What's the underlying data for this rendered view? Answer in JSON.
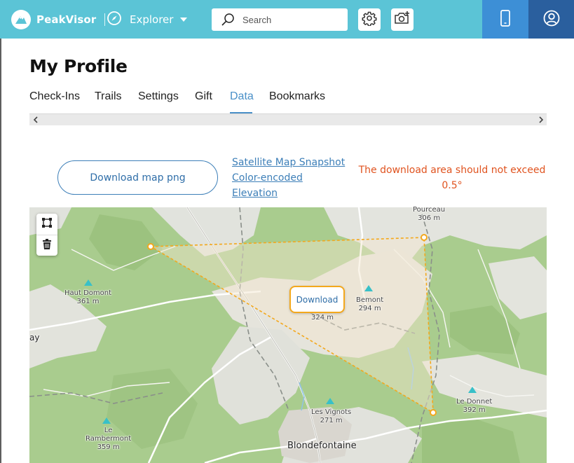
{
  "header": {
    "brand": "PeakVisor",
    "explorer_label": "Explorer",
    "search_placeholder": "Search"
  },
  "page": {
    "title": "My Profile",
    "tabs": [
      {
        "label": "Check-Ins",
        "active": false
      },
      {
        "label": "Trails",
        "active": false
      },
      {
        "label": "Settings",
        "active": false
      },
      {
        "label": "Gift",
        "active": false
      },
      {
        "label": "Data",
        "active": true
      },
      {
        "label": "Bookmarks",
        "active": false
      }
    ]
  },
  "actions": {
    "download_png_label": "Download map png",
    "links": [
      "Satellite Map Snapshot",
      "Color-encoded",
      "Elevation"
    ],
    "warning": "The download area should not exceed 0.5°"
  },
  "map": {
    "download_label": "Download",
    "labels": {
      "haut_domont": {
        "name": "Haut Domont",
        "elev": "361 m"
      },
      "pourceau": {
        "name": "Pourceau",
        "elev": "306 m"
      },
      "bemont": {
        "name": "Bemont",
        "elev": "294 m"
      },
      "mid_peak": {
        "elev": "324 m"
      },
      "le_donnet": {
        "name": "Le Donnet",
        "elev": "392 m"
      },
      "le_rambermont": {
        "name1": "Le",
        "name2": "Rambermont",
        "elev": "359 m"
      },
      "les_vignots": {
        "name": "Les Vignots",
        "elev": "271 m"
      },
      "town": "Blondefontaine",
      "edge_fragment": "ay"
    }
  },
  "colors": {
    "header_bg": "#5bc4d6",
    "phone_bg": "#3d8fd6",
    "account_bg": "#2a5f9e",
    "accent": "#4a90c8",
    "warning": "#e0531f",
    "selection": "#f3a81d"
  },
  "icons": {
    "logo": "peakvisor-logo-icon",
    "compass": "compass-icon",
    "search": "search-icon",
    "settings": "gear-icon",
    "camera": "add-camera-icon",
    "phone": "phone-icon",
    "account": "account-icon",
    "draw": "draw-polygon-icon",
    "trash": "trash-icon"
  }
}
